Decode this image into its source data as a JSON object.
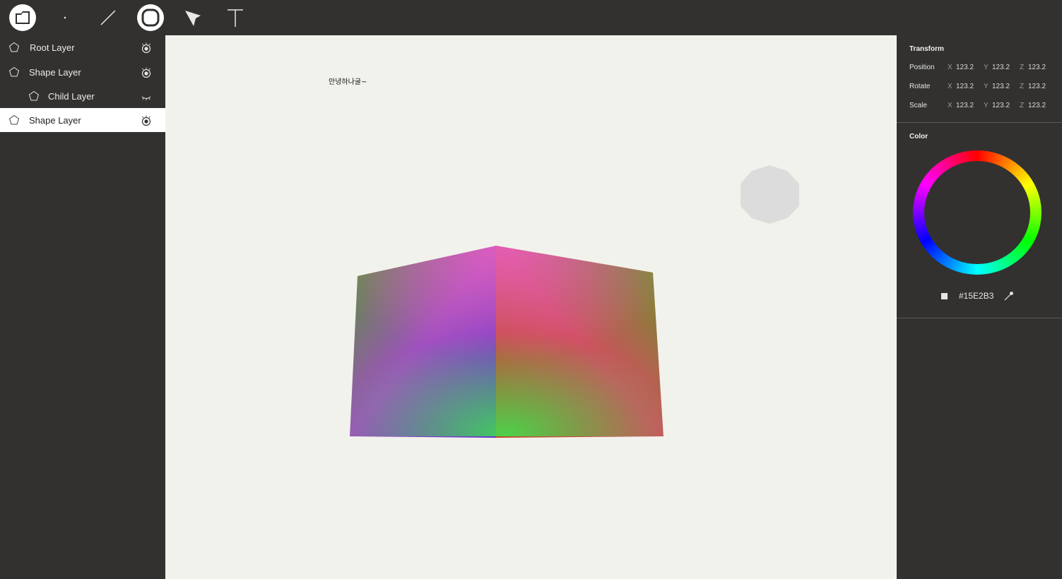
{
  "toolbar": {
    "tools": [
      {
        "name": "layer-tool",
        "active": true
      },
      {
        "name": "point-tool"
      },
      {
        "name": "line-tool"
      },
      {
        "name": "shape-tool",
        "active": true
      },
      {
        "name": "select-tool"
      },
      {
        "name": "text-tool"
      }
    ]
  },
  "layers": [
    {
      "label": "Root Layer",
      "indent": 0,
      "visible": true,
      "selected": false
    },
    {
      "label": "Shape Layer",
      "indent": 0,
      "visible": true,
      "selected": false
    },
    {
      "label": "Child Layer",
      "indent": 1,
      "visible": false,
      "selected": false
    },
    {
      "label": "Shape Layer",
      "indent": 0,
      "visible": true,
      "selected": true
    }
  ],
  "canvas": {
    "text": "안녕하나굴~",
    "cube_colors": [
      "#e060b0",
      "#50a030",
      "#7040c0",
      "#40e050",
      "#c04020"
    ],
    "octagon_color": "#dcdcdc"
  },
  "transform": {
    "title": "Transform",
    "rows": [
      {
        "label": "Position",
        "x": "123.2",
        "y": "123.2",
        "z": "123.2"
      },
      {
        "label": "Rotate",
        "x": "123.2",
        "y": "123.2",
        "z": "123.2"
      },
      {
        "label": "Scale",
        "x": "123.2",
        "y": "123.2",
        "z": "123.2"
      }
    ],
    "axis_labels": {
      "x": "X",
      "y": "Y",
      "z": "Z"
    }
  },
  "color": {
    "title": "Color",
    "hex": "#15E2B3",
    "swatch": "#e6e6e6"
  },
  "theme": {
    "panel_bg": "#323130",
    "canvas_bg": "#f2f2ec",
    "selected_row": "#ffffff"
  }
}
